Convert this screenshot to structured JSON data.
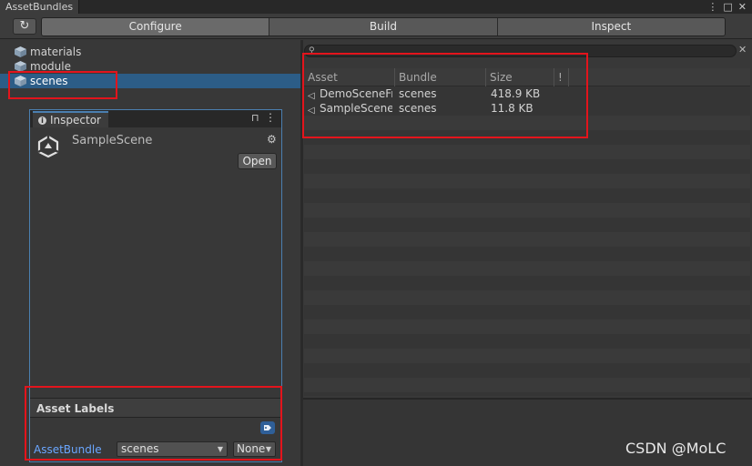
{
  "window": {
    "tab_label": "AssetBundles",
    "menu_icon": "⋮",
    "maximize_icon": "□",
    "close_icon": "✕"
  },
  "toolbar": {
    "refresh_icon": "↻",
    "tabs": [
      {
        "label": "Configure",
        "active": true
      },
      {
        "label": "Build",
        "active": false
      },
      {
        "label": "Inspect",
        "active": false
      }
    ]
  },
  "tree": {
    "items": [
      {
        "label": "materials",
        "selected": false
      },
      {
        "label": "module",
        "selected": false
      },
      {
        "label": "scenes",
        "selected": true
      }
    ]
  },
  "inspector": {
    "tab_label": "Inspector",
    "info_glyph": "i",
    "lock_icon": "⊓",
    "menu_icon": "⋮",
    "object_name": "SampleScene",
    "gear_icon": "⚙",
    "open_label": "Open",
    "asset_labels_title": "Asset Labels",
    "asset_bundle_label": "AssetBundle",
    "asset_bundle_value": "scenes",
    "variant_value": "None"
  },
  "search": {
    "icon": "⚲",
    "clear_icon": "✕",
    "value": ""
  },
  "table": {
    "columns": [
      "Asset",
      "Bundle",
      "Size",
      "!"
    ],
    "rows": [
      {
        "asset": "DemoSceneFr",
        "bundle": "scenes",
        "size": "418.9 KB"
      },
      {
        "asset": "SampleScene",
        "bundle": "scenes",
        "size": "11.8 KB"
      }
    ]
  },
  "watermark": "CSDN @MoLC",
  "colors": {
    "selection": "#2c5d87",
    "highlight_box": "#e3141c",
    "link_blue": "#6aa6ff"
  }
}
